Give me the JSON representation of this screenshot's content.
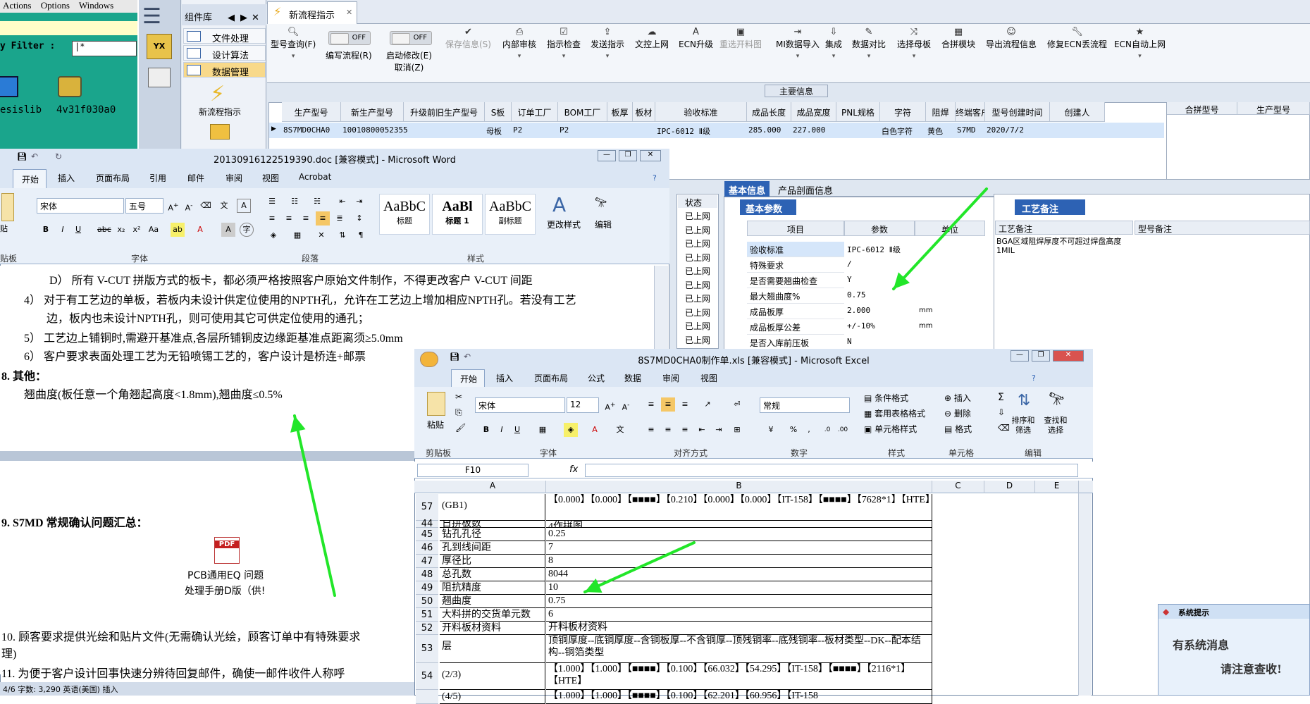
{
  "green_app": {
    "menu": [
      "Actions",
      "Options",
      "Windows"
    ],
    "filter_label": "y Filter :",
    "filter_value": "|*",
    "icons": [
      {
        "name": "esislib"
      },
      {
        "name": "4v31f030a0"
      }
    ]
  },
  "main_app": {
    "component_library": "组件库",
    "components": [
      "文件处理",
      "设计算法",
      "数据管理"
    ],
    "launch_label": "新流程指示",
    "tab_title": "新流程指示",
    "toolbar": [
      {
        "label": "型号查询(F)",
        "icon": "search-icon"
      },
      {
        "label": "编写流程(R)",
        "icon": "toggle"
      },
      {
        "label": "启动修改(E)",
        "sub": "取消(Z)",
        "icon": "toggle"
      },
      {
        "label": "保存信息(S)",
        "icon": "check-icon",
        "disabled": true
      },
      {
        "label": "内部审核",
        "icon": "printer-icon"
      },
      {
        "label": "指示检查",
        "icon": "checkbox-icon"
      },
      {
        "label": "发送指示",
        "icon": "upload-icon"
      },
      {
        "label": "文控上网",
        "icon": "cloud-icon"
      },
      {
        "label": "ECN升级",
        "icon": "font-icon"
      },
      {
        "label": "重选开料图",
        "icon": "image-icon",
        "disabled": true
      },
      {
        "label": "MI数据导入",
        "icon": "import-icon"
      },
      {
        "label": "集成",
        "icon": "download-icon"
      },
      {
        "label": "数据对比",
        "icon": "wand-icon"
      },
      {
        "label": "选择母板",
        "icon": "shuffle-icon"
      },
      {
        "label": "合拼模块",
        "icon": "grid-icon"
      },
      {
        "label": "导出流程信息",
        "icon": "smile-icon"
      },
      {
        "label": "修复ECN丢流程",
        "icon": "wrench-icon"
      },
      {
        "label": "ECN自动上网",
        "icon": "star-icon"
      }
    ],
    "toggle_off": "OFF",
    "section_label": "主要信息",
    "grid_headers": [
      "生产型号",
      "新生产型号",
      "升级前旧生产型号",
      "S板",
      "订单工厂",
      "BOM工厂",
      "板厚",
      "板材",
      "验收标准",
      "成品长度",
      "成品宽度",
      "PNL规格",
      "字符",
      "阻焊",
      "终端客户代码",
      "型号创建时间",
      "创建人"
    ],
    "grid_row": [
      "8S7MD0CHA0",
      "10010800052355",
      "",
      "母板",
      "P2",
      "P2",
      "",
      "",
      "IPC-6012 Ⅱ级",
      "285.000",
      "227.000",
      "",
      "白色字符",
      "黄色",
      "S7MD",
      "2020/7/2",
      ""
    ],
    "right_grid_headers": [
      "合拼型号",
      "生产型号"
    ],
    "status_header": "状态",
    "status_values": [
      "已上网",
      "已上网",
      "已上网",
      "已上网",
      "已上网",
      "已上网",
      "已上网",
      "已上网",
      "已上网",
      "已上网"
    ],
    "info_tabs": [
      "基本信息",
      "产品剖面信息"
    ],
    "basic_params_tab": "基本参数",
    "kv_headers": [
      "项目",
      "参数",
      "单位"
    ],
    "kv_rows": [
      {
        "item": "验收标准",
        "value": "IPC-6012 Ⅱ级",
        "unit": ""
      },
      {
        "item": "特殊要求",
        "value": "/",
        "unit": ""
      },
      {
        "item": "是否需要翘曲检查",
        "value": "Y",
        "unit": ""
      },
      {
        "item": "最大翘曲度%",
        "value": "0.75",
        "unit": ""
      },
      {
        "item": "成品板厚",
        "value": "2.000",
        "unit": "mm"
      },
      {
        "item": "成品板厚公差",
        "value": "+/-10%",
        "unit": "mm"
      },
      {
        "item": "是否入库前压板",
        "value": "N",
        "unit": ""
      }
    ],
    "craft_tab": "工艺备注",
    "craft_headers": [
      "工艺备注",
      "型号备注"
    ],
    "craft_note": "BGA区域阻焊厚度不可超过焊盘高度1MIL"
  },
  "word": {
    "title": "20130916122519390.doc [兼容模式] - Microsoft Word",
    "tabs": [
      "开始",
      "插入",
      "页面布局",
      "引用",
      "邮件",
      "审阅",
      "视图",
      "Acrobat"
    ],
    "font_name": "宋体",
    "font_size": "五号",
    "styles": [
      {
        "preview": "AaBbC",
        "name": "标题"
      },
      {
        "preview": "AaBl",
        "name": "标题 1"
      },
      {
        "preview": "AaBbC",
        "name": "副标题"
      }
    ],
    "change_styles": "更改样式",
    "edit": "编辑",
    "groups": [
      "贴板",
      "字体",
      "段落",
      "样式"
    ],
    "paste_label": "贴",
    "lines": [
      "D） 所有 V-CUT 拼版方式的板卡，都必须严格按照客户原始文件制作，不得更改客户 V-CUT 间距",
      "4） 对于有工艺边的单板，若板内未设计供定位使用的NPTH孔，允许在工艺边上增加相应NPTH孔。若没有工艺",
      "边，板内也未设计NPTH孔，则可使用其它可供定位使用的通孔；",
      "5） 工艺边上铺铜时,需避开基准点,各层所铺铜皮边缘距基准点距离须≥5.0mm",
      "6） 客户要求表面处理工艺为无铅喷锡工艺的，客户设计是桥连+邮票",
      "8.  其他：",
      "翘曲度(板任意一个角翘起高度<1.8mm),翘曲度≤0.5%",
      "9.  S7MD 常规确认问题汇总：",
      "PCB通用EQ 问题",
      "处理手册D版（供!",
      "10.  顾客要求提供光绘和贴片文件(无需确认光绘，顾客订单中有特殊要求",
      "理)",
      "11. 为便于客户设计回事快速分辨待回复邮件，确使一邮件收件人称呼"
    ],
    "pdf_label": "PDF",
    "status": "4/6   字数: 3,290    英语(美国)     插入"
  },
  "excel": {
    "title": "8S7MD0CHA0制作单.xls [兼容模式] - Microsoft Excel",
    "tabs": [
      "开始",
      "插入",
      "页面布局",
      "公式",
      "数据",
      "审阅",
      "视图"
    ],
    "font_name": "宋体",
    "font_size": "12",
    "number_format": "常规",
    "groups": [
      "剪贴板",
      "字体",
      "对齐方式",
      "数字",
      "样式",
      "单元格",
      "编辑"
    ],
    "paste_label": "粘贴",
    "style_items": [
      "条件格式",
      "套用表格格式",
      "单元格样式"
    ],
    "cell_items": [
      "插入",
      "删除",
      "格式"
    ],
    "sort_label": "排序和筛选",
    "find_label": "查找和选择",
    "name_box": "F10",
    "fx": "fx",
    "columns": [
      "A",
      "B",
      "C",
      "D",
      "E"
    ],
    "rows": [
      {
        "num": "57",
        "a": "(GB1)",
        "b": "【0.000】【0.000】【■■■■】【0.210】【0.000】【0.000】【IT-158】【■■■■】【7628*1】【HTE】"
      },
      {
        "num": "44",
        "a": "日拼板数",
        "b": "4作拼图"
      },
      {
        "num": "45",
        "a": "钻孔孔径",
        "b": "0.25"
      },
      {
        "num": "46",
        "a": "孔到线间距",
        "b": "7"
      },
      {
        "num": "47",
        "a": "厚径比",
        "b": "8"
      },
      {
        "num": "48",
        "a": "总孔数",
        "b": "8044"
      },
      {
        "num": "49",
        "a": "阻抗精度",
        "b": "10"
      },
      {
        "num": "50",
        "a": "翘曲度",
        "b": "0.75"
      },
      {
        "num": "51",
        "a": "大料拼的交货单元数",
        "b": "6"
      },
      {
        "num": "52",
        "a": "开料板材资料",
        "b": "开料板材资料"
      },
      {
        "num": "53",
        "a": "层",
        "b": "顶铜厚度--底铜厚度--含铜板厚--不含铜厚--顶残铜率--底残铜率--板材类型--DK--配本结构--铜箔类型"
      },
      {
        "num": "54",
        "a": "(2/3)",
        "b": "【1.000】【1.000】【■■■■】【0.100】【66.032】【54.295】【IT-158】【■■■■】【2116*1】【HTE】"
      },
      {
        "num": "",
        "a": "(4/5)",
        "b": "【1.000】【1.000】【■■■■】【0.100】【62.201】【60.956】【IT-158"
      }
    ]
  },
  "notice": {
    "title": "系统提示",
    "line1": "有系统消息",
    "line2": "请注意查收!"
  },
  "colors": {
    "arrow": "#22e629",
    "accent": "#2d62b4",
    "green_app": "#1aa58c"
  }
}
